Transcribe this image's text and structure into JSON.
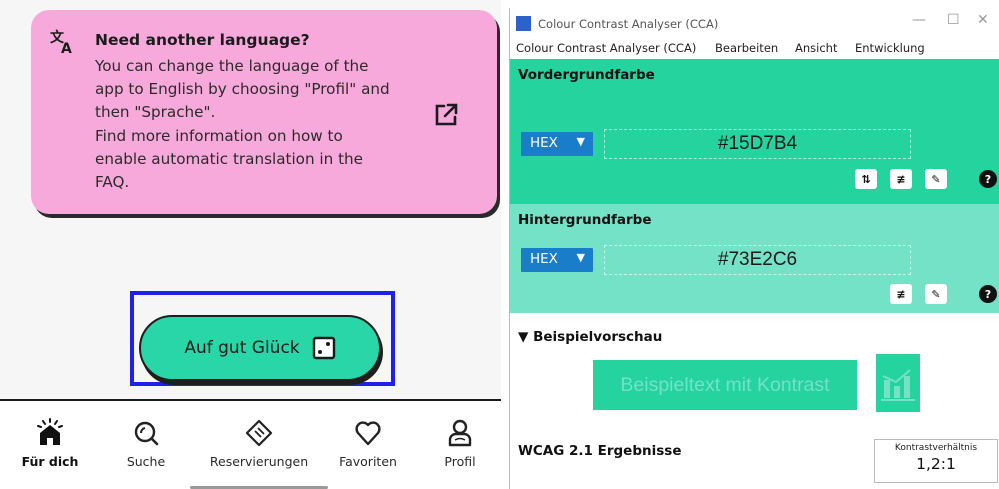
{
  "app": {
    "info_card": {
      "title": "Need another language?",
      "lines": [
        "You can change the language of the",
        "app to English by choosing \"Profil\" and",
        "then \"Sprache\".",
        "Find more information on how to",
        "enable automatic translation in the",
        "FAQ."
      ],
      "icon": "translate-icon",
      "link_icon": "external-link-icon"
    },
    "lucky_button": {
      "label": "Auf gut Glück",
      "icon": "dice-icon"
    },
    "nav": [
      {
        "label": "Für dich",
        "icon": "home-icon",
        "active": true
      },
      {
        "label": "Suche",
        "icon": "search-icon",
        "active": false
      },
      {
        "label": "Reservierungen",
        "icon": "ticket-icon",
        "active": false
      },
      {
        "label": "Favoriten",
        "icon": "heart-icon",
        "active": false
      },
      {
        "label": "Profil",
        "icon": "profile-icon",
        "active": false
      }
    ],
    "colors": {
      "card": "#f8a9db",
      "button": "#29d6a8",
      "highlight": "#1f22e6"
    }
  },
  "cca": {
    "window_title": "Colour Contrast Analyser (CCA)",
    "menu": [
      "Colour Contrast Analyser (CCA)",
      "Bearbeiten",
      "Ansicht",
      "Entwicklung"
    ],
    "foreground": {
      "title": "Vordergrundfarbe",
      "format": "HEX",
      "value": "#15D7B4",
      "color": "#24d39e"
    },
    "background": {
      "title": "Hintergrundfarbe",
      "format": "HEX",
      "value": "#73E2C6",
      "color": "#73e2c6"
    },
    "preview": {
      "title": "▼ Beispielvorschau",
      "sample_text": "Beispieltext mit Kontrast"
    },
    "results": {
      "title": "WCAG 2.1 Ergebnisse",
      "ratio_label": "Kontrastverhältnis",
      "ratio_value": "1,2:1"
    }
  }
}
